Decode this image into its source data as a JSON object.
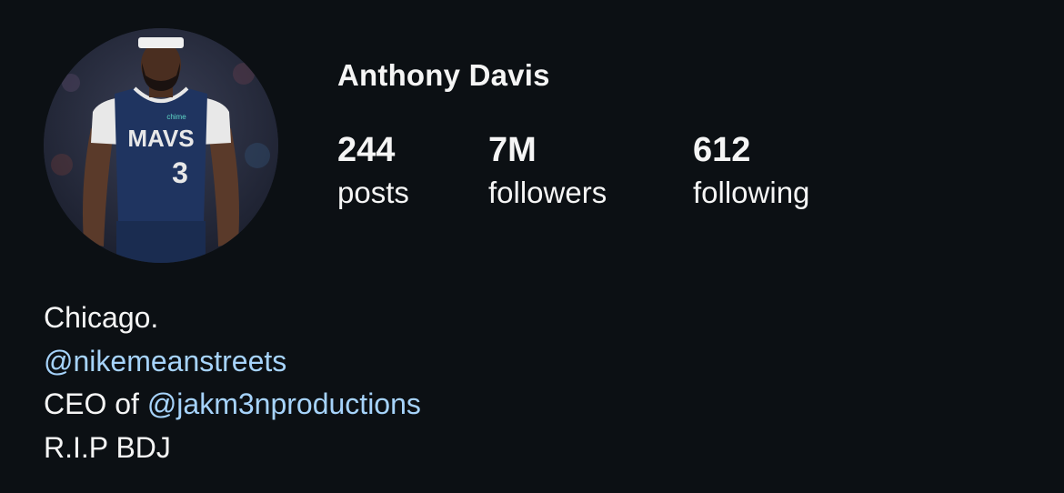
{
  "profile": {
    "username": "Anthony Davis",
    "avatar_icon": "player-photo",
    "stats": [
      {
        "value": "244",
        "label": "posts"
      },
      {
        "value": "7M",
        "label": "followers"
      },
      {
        "value": "612",
        "label": "following"
      }
    ],
    "bio": {
      "line1": "Chicago.",
      "line2_mention": "@nikemeanstreets",
      "line3_prefix": "CEO of ",
      "line3_mention": "@jakm3nproductions",
      "line4": "R.I.P BDJ"
    },
    "jersey": {
      "team_text": "MAVS",
      "number": "3",
      "sponsor": "chime"
    }
  },
  "colors": {
    "background": "#0c1014",
    "text": "#f5f5f5",
    "mention": "#a6d3fb",
    "jersey_navy": "#1f3460"
  }
}
